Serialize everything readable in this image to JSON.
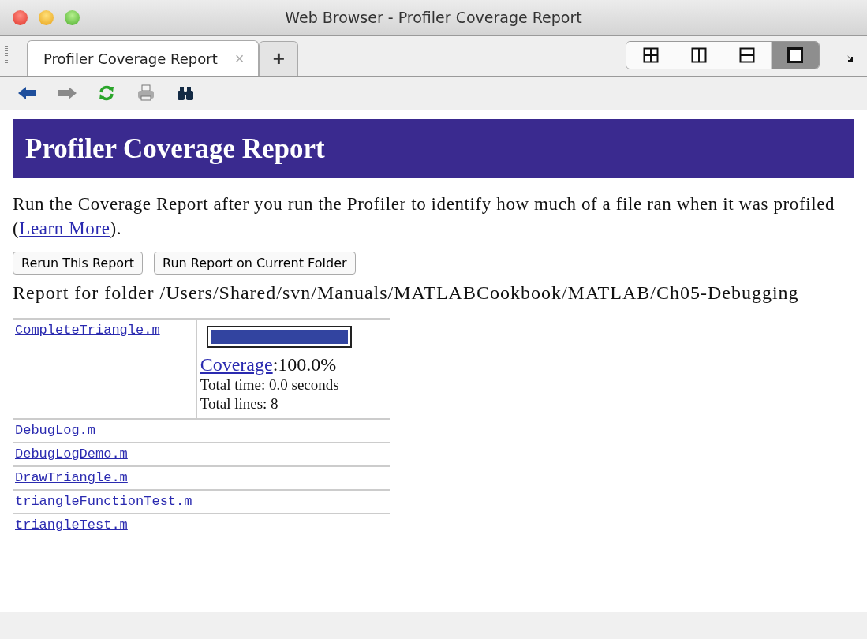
{
  "window": {
    "title": "Web Browser - Profiler Coverage Report"
  },
  "tabs": [
    {
      "label": "Profiler Coverage Report",
      "selected": true,
      "close": "×"
    }
  ],
  "new_tab": "+",
  "layout_buttons": [
    {
      "kind": "grid",
      "selected": false
    },
    {
      "kind": "columns",
      "selected": false
    },
    {
      "kind": "rows",
      "selected": false
    },
    {
      "kind": "single",
      "selected": true
    }
  ],
  "toolbar": [
    {
      "kind": "back",
      "disabled": false
    },
    {
      "kind": "forward",
      "disabled": true
    },
    {
      "kind": "refresh",
      "disabled": false
    },
    {
      "kind": "print",
      "disabled": false
    },
    {
      "kind": "find",
      "disabled": false
    }
  ],
  "page": {
    "heading": "Profiler Coverage Report",
    "intro": "Run the Coverage Report after you run the Profiler to identify how much of a file ran when it was profiled (",
    "intro_link": "Learn More",
    "intro_end": ").",
    "buttons": [
      "Rerun This Report",
      "Run Report on Current Folder"
    ],
    "folder_line": "Report for folder /Users/Shared/svn/Manuals/MATLABCookbook/MATLAB/Ch05-Debugging",
    "files": [
      {
        "name": "CompleteTriangle.m",
        "coverage": {
          "level": 1.0,
          "link": "Coverage",
          "value": ":100.0%",
          "time": "Total time: 0.0 seconds",
          "lines": "Total lines: 8"
        }
      },
      {
        "name": "DebugLog.m"
      },
      {
        "name": "DebugLogDemo.m"
      },
      {
        "name": "DrawTriangle.m"
      },
      {
        "name": "triangleFunctionTest.m"
      },
      {
        "name": "triangleTest.m"
      }
    ]
  }
}
